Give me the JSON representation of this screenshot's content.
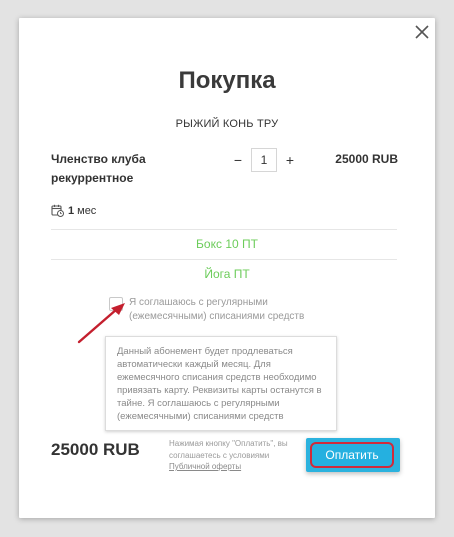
{
  "modal": {
    "title": "Покупка",
    "club_name": "РЫЖИЙ КОНЬ ТРУ"
  },
  "product": {
    "name": "Членство клуба рекуррентное",
    "quantity": "1",
    "price": "25000 RUB",
    "duration_value": "1",
    "duration_unit": "мес"
  },
  "services": [
    "Бокс 10 ПТ",
    "Йога ПТ"
  ],
  "agreement": {
    "checkbox_label": "Я соглашаюсь с регулярными (ежемесячными) списаниями средств",
    "checked": false,
    "tooltip": "Данный абонемент будет продлеваться автоматически каждый месяц. Для ежемесячного списания средств необходимо привязать карту. Реквизиты карты останутся в тайне. Я соглашаюсь с регулярными (ежемесячными) списаниями средств"
  },
  "footer": {
    "total": "25000 RUB",
    "legal_text": "Нажимая кнопку \"Оплатить\", вы соглашаетесь с условиями",
    "legal_link": "Публичной оферты",
    "pay_label": "Оплатить"
  },
  "qty_controls": {
    "minus": "−",
    "plus": "+"
  },
  "colors": {
    "service_green": "#6ccc5a",
    "pay_blue": "#25b0e0",
    "highlight_red": "#d12a3a"
  }
}
